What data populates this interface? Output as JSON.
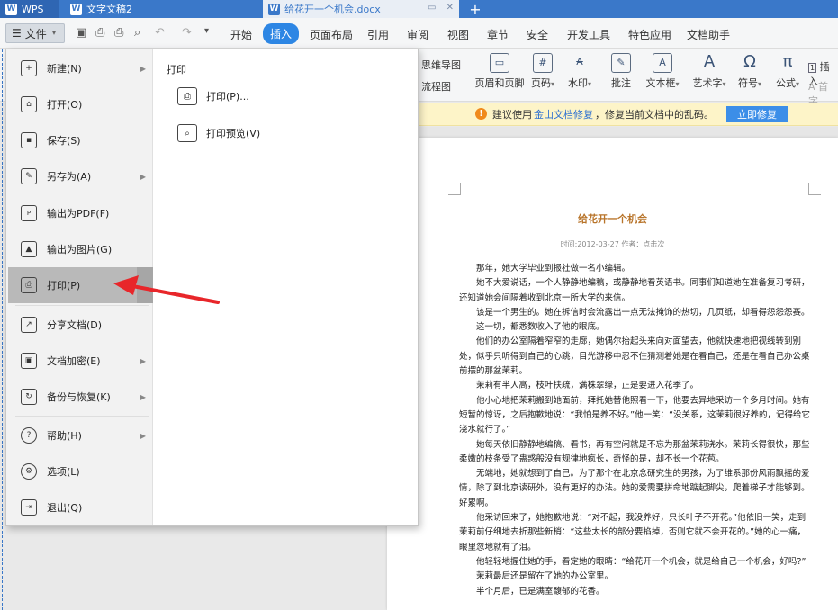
{
  "tabs": [
    {
      "label": "WPS"
    },
    {
      "label": "文字文稿2"
    },
    {
      "label": "给花开一个机会.docx",
      "active": true
    }
  ],
  "tab_controls": {
    "restore": "▭",
    "close": "✕",
    "new_tab": "+"
  },
  "menubar": {
    "file_label": "文件",
    "items": [
      "开始",
      "插入",
      "页面布局",
      "引用",
      "审阅",
      "视图",
      "章节",
      "安全",
      "开发工具",
      "特色应用",
      "文档助手"
    ],
    "active": "插入"
  },
  "ribbon": {
    "left_items": [
      "思维导图",
      "流程图"
    ],
    "buttons": [
      "页眉和页脚",
      "页码",
      "水印",
      "批注",
      "文本框",
      "艺术字",
      "符号",
      "公式"
    ],
    "right_items": [
      "插入",
      "首字"
    ]
  },
  "notice": {
    "prefix": "建议使用",
    "link": "金山文档修复",
    "suffix": "，修复当前文档中的乱码。",
    "button": "立即修复"
  },
  "file_menu": {
    "items": [
      {
        "label": "新建(N)",
        "icon": "new-doc-icon",
        "has_submenu": true
      },
      {
        "label": "打开(O)",
        "icon": "folder-icon",
        "has_submenu": false
      },
      {
        "label": "保存(S)",
        "icon": "save-icon",
        "has_submenu": false
      },
      {
        "label": "另存为(A)",
        "icon": "save-as-icon",
        "has_submenu": true
      },
      {
        "label": "输出为PDF(F)",
        "icon": "pdf-icon",
        "has_submenu": false
      },
      {
        "label": "输出为图片(G)",
        "icon": "image-icon",
        "has_submenu": false
      },
      {
        "label": "打印(P)",
        "icon": "printer-icon",
        "has_submenu": true,
        "selected": true
      },
      {
        "label": "分享文档(D)",
        "icon": "share-icon",
        "has_submenu": false
      },
      {
        "label": "文档加密(E)",
        "icon": "lock-icon",
        "has_submenu": true
      },
      {
        "label": "备份与恢复(K)",
        "icon": "backup-icon",
        "has_submenu": true
      },
      {
        "label": "帮助(H)",
        "icon": "help-icon",
        "has_submenu": true
      },
      {
        "label": "选项(L)",
        "icon": "gear-icon",
        "has_submenu": false
      },
      {
        "label": "退出(Q)",
        "icon": "exit-icon",
        "has_submenu": false
      }
    ],
    "submenu_title": "打印",
    "submenu_items": [
      {
        "label": "打印(P)...",
        "icon": "printer-icon"
      },
      {
        "label": "打印预览(V)",
        "icon": "print-preview-icon"
      }
    ]
  },
  "document": {
    "title": "给花开一个机会",
    "meta": "时间:2012-03-27  作者：点击次",
    "paragraphs": [
      "那年，她大学毕业到报社做一名小编辑。",
      "她不大爱说话，一个人静静地编稿，或静静地看英语书。同事们知道她在准备复习考研，还知道她会间隔着收到北京一所大学的来信。",
      "该是一个男生的。她在拆信时会流露出一点无法掩饰的热切，几页纸，却看得怨怨怨赛。",
      "这一切，都悉数收入了他的眼底。",
      "他们的办公室隔着窄窄的走廊，她偶尔抬起头来向对面望去，他就快速地把视线转到别处，似乎只听得到自己的心跳，目光游移中忍不住猜测着她是在看自己，还是在看自己办公桌前摆的那盆茉莉。",
      "茉莉有半人高，枝叶扶疏，满株翠绿，正是要进入花季了。",
      "他小心地把茉莉搬到她面前，拜托她替他照看一下，他要去异地采访一个多月时间。她有短暂的惊讶，之后抱歉地说：“我怕是养不好。”他一笑：“没关系，这茉莉很好养的，记得给它浇水就行了。”",
      "她每天依旧静静地编稿、看书，再有空闲就是不忘为那盆茉莉浇水。茉莉长得很快，那些柔嫩的枝条受了蛊惑般没有规律地疯长，奇怪的是，却不长一个花苞。",
      "无端地，她就想到了自己。为了那个在北京念研究生的男孩，为了维系那份风雨飘摇的爱情，除了到北京读研外，没有更好的办法。她的爱需要拼命地踮起脚尖，爬着梯子才能够到。好累啊。",
      "他采访回来了，她抱歉地说：“对不起，我没养好，只长叶子不开花。”他依旧一笑，走到茉莉前仔细地去折那些新梢：“这些太长的部分要掐掉，否则它就不会开花的。”她的心一痛，眼里忽地就有了泪。",
      "他轻轻地握住她的手，看定她的眼睛：“给花开一个机会，就是给自己一个机会，好吗?”",
      "茉莉最后还是留在了她的办公室里。",
      "半个月后，已是满室馥郁的花香。"
    ]
  }
}
